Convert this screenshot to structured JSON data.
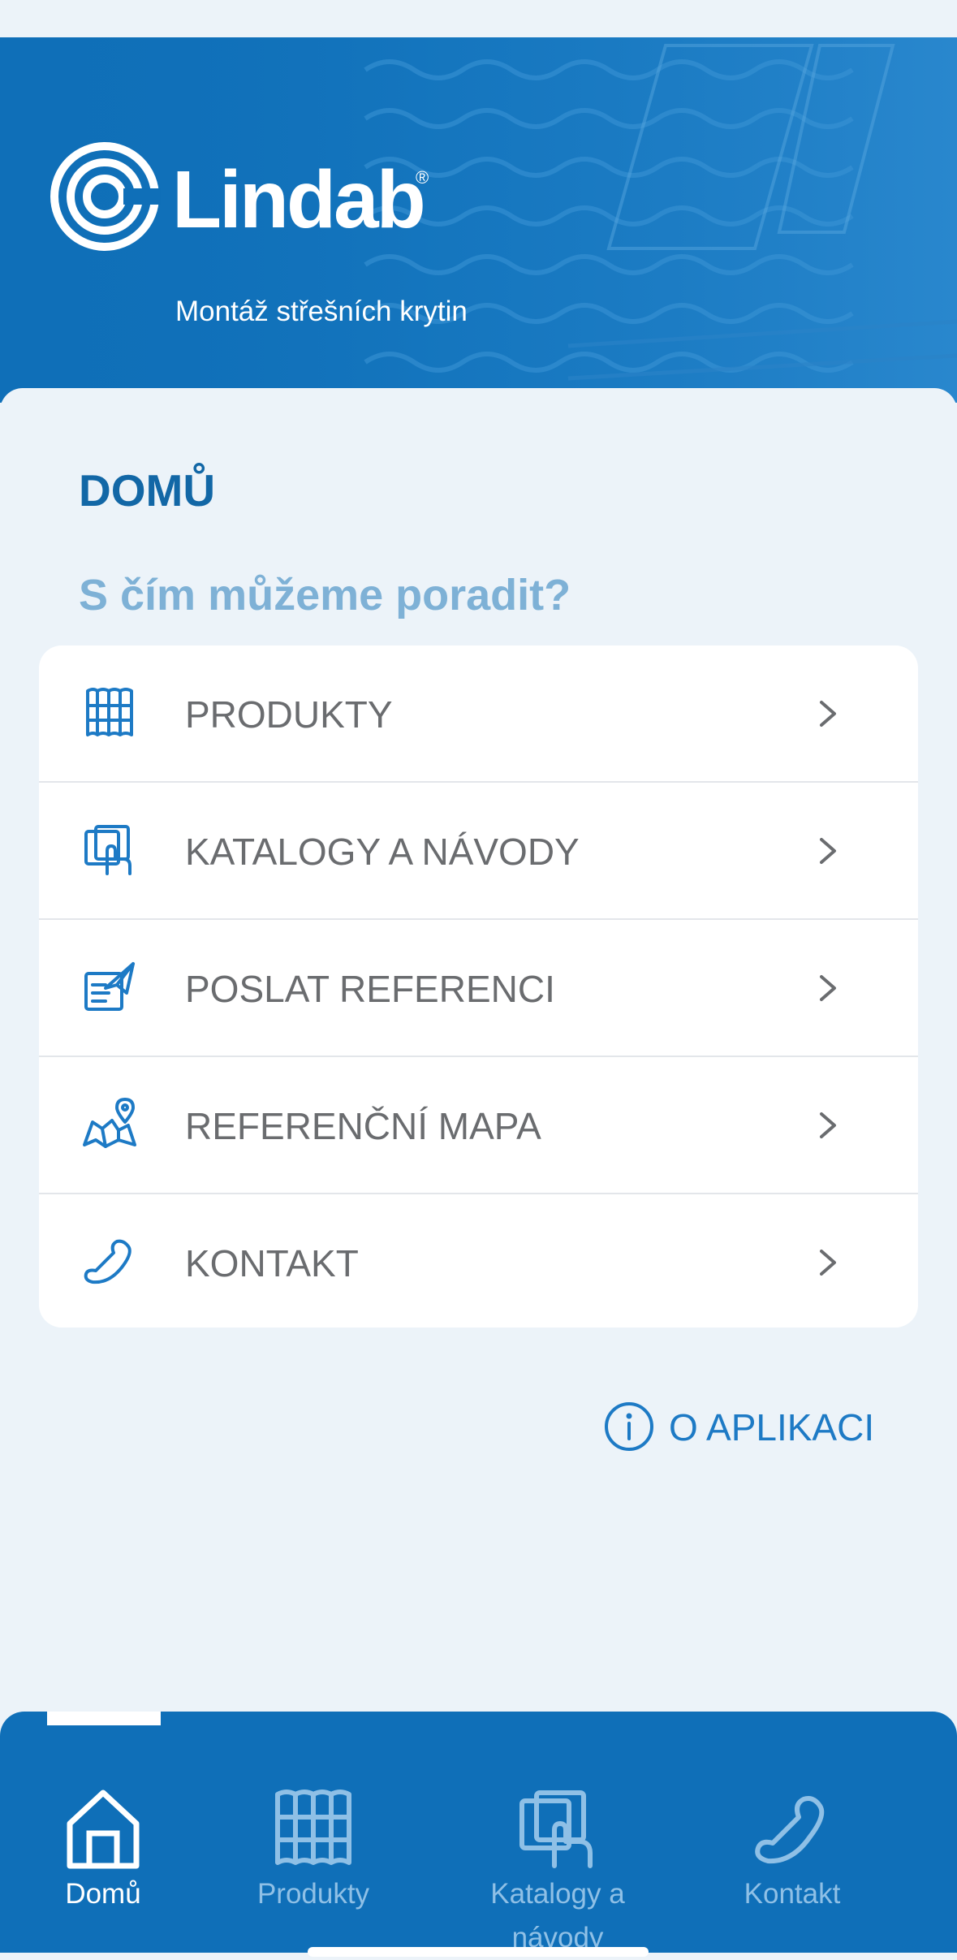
{
  "header": {
    "brand_name": "Lindab",
    "brand_mark": "®",
    "subtitle": "Montáž střešních krytin",
    "logo_icon": "lindab-logo-icon"
  },
  "page": {
    "title": "DOMŮ",
    "question": "S čím můžeme poradit?"
  },
  "menu": {
    "items": [
      {
        "label": "PRODUKTY",
        "icon": "roof-panel-icon"
      },
      {
        "label": "KATALOGY A NÁVODY",
        "icon": "catalog-hand-icon"
      },
      {
        "label": "POSLAT REFERENCI",
        "icon": "send-reference-icon"
      },
      {
        "label": "REFERENČNÍ MAPA",
        "icon": "map-pin-icon"
      },
      {
        "label": "KONTAKT",
        "icon": "phone-icon"
      }
    ],
    "chevron_icon": "chevron-right-icon"
  },
  "about": {
    "label": "O APLIKACI",
    "icon": "info-icon"
  },
  "tabbar": {
    "active_index": 0,
    "tabs": [
      {
        "label": "Domů",
        "icon": "home-icon"
      },
      {
        "label": "Produkty",
        "icon": "roof-panel-icon"
      },
      {
        "label": "Katalogy a\nnávody",
        "icon": "catalog-hand-icon"
      },
      {
        "label": "Kontakt",
        "icon": "phone-icon"
      }
    ]
  },
  "colors": {
    "brand_blue": "#0f6fb8",
    "title_blue": "#1267a6",
    "question_blue": "#7eb1d6",
    "link_blue": "#1d7ac5",
    "menu_text": "#6a6c6f",
    "background": "#ecf3f9"
  }
}
